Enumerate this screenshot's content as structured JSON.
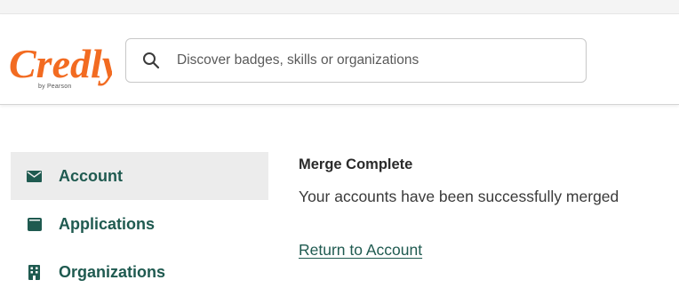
{
  "header": {
    "logo": {
      "brand": "Credly",
      "byline": "by Pearson",
      "color": "#f26b21"
    },
    "search": {
      "icon": "search-icon",
      "placeholder": "Discover badges, skills or organizations",
      "value": ""
    }
  },
  "sidebar": {
    "items": [
      {
        "label": "Account",
        "icon": "envelope-icon",
        "active": true
      },
      {
        "label": "Applications",
        "icon": "app-window-icon",
        "active": false
      },
      {
        "label": "Organizations",
        "icon": "building-icon",
        "active": false
      }
    ]
  },
  "main": {
    "title": "Merge Complete",
    "message": "Your accounts have been successfully merged",
    "link": "Return to Account"
  },
  "colors": {
    "accent": "#1f5a50",
    "brand": "#f26b21",
    "active_bg": "#ececec"
  }
}
